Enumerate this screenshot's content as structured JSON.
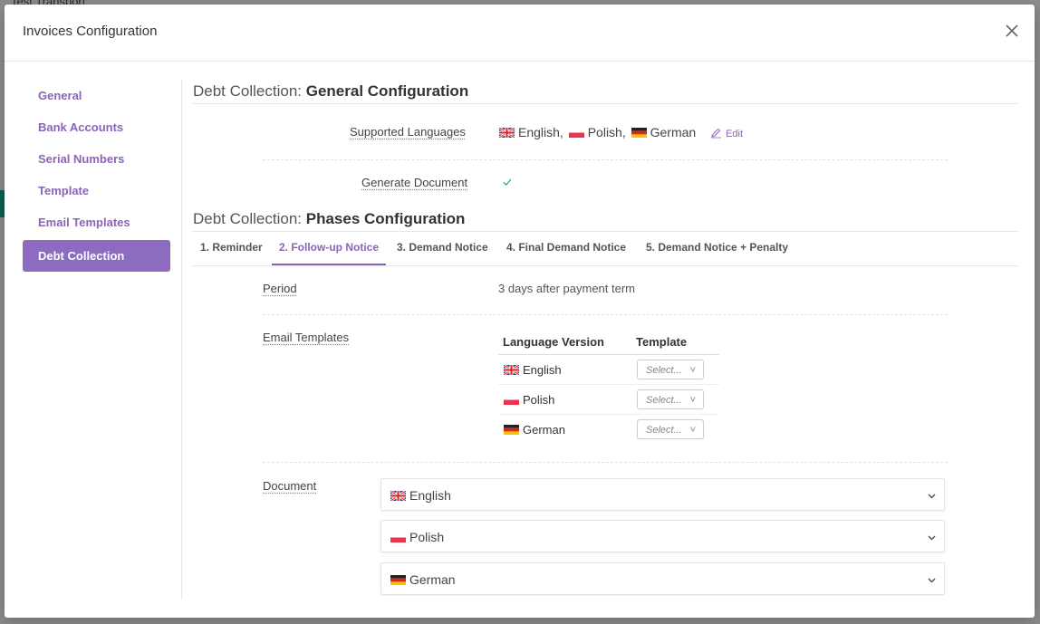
{
  "background": {
    "title": "Test Transport"
  },
  "modal": {
    "title": "Invoices Configuration"
  },
  "sidebar": {
    "items": [
      {
        "label": "General"
      },
      {
        "label": "Bank Accounts"
      },
      {
        "label": "Serial Numbers"
      },
      {
        "label": "Template"
      },
      {
        "label": "Email Templates"
      },
      {
        "label": "Debt Collection",
        "active": true
      }
    ]
  },
  "general_config": {
    "title_prefix": "Debt Collection:",
    "title_main": "General Configuration",
    "supported_languages_label": "Supported Languages",
    "languages": [
      {
        "name": "English,",
        "flag": "uk-flag"
      },
      {
        "name": "Polish,",
        "flag": "poland-flag"
      },
      {
        "name": "German",
        "flag": "germany-flag"
      }
    ],
    "edit_label": "Edit",
    "generate_document_label": "Generate Document",
    "generate_document_checked": true
  },
  "phases_config": {
    "title_prefix": "Debt Collection:",
    "title_main": "Phases Configuration",
    "tabs": [
      {
        "label": "1. Reminder"
      },
      {
        "label": "2. Follow-up Notice",
        "active": true
      },
      {
        "label": "3. Demand Notice"
      },
      {
        "label": "4. Final Demand Notice"
      },
      {
        "label": "5. Demand Notice + Penalty"
      }
    ],
    "period_label": "Period",
    "period_value": "3 days after payment term",
    "email_templates_label": "Email Templates",
    "table_headers": [
      "Language Version",
      "Template"
    ],
    "table_rows": [
      {
        "language": "English",
        "flag": "uk-flag",
        "template_placeholder": "Select..."
      },
      {
        "language": "Polish",
        "flag": "poland-flag",
        "template_placeholder": "Select..."
      },
      {
        "language": "German",
        "flag": "germany-flag",
        "template_placeholder": "Select..."
      }
    ],
    "document_label": "Document",
    "documents": [
      {
        "language": "English",
        "flag": "uk-flag"
      },
      {
        "language": "Polish",
        "flag": "poland-flag"
      },
      {
        "language": "German",
        "flag": "germany-flag"
      }
    ]
  },
  "colors": {
    "accent": "#8c63b8",
    "active_bg": "#8c6bc0",
    "check": "#1aa58d"
  }
}
